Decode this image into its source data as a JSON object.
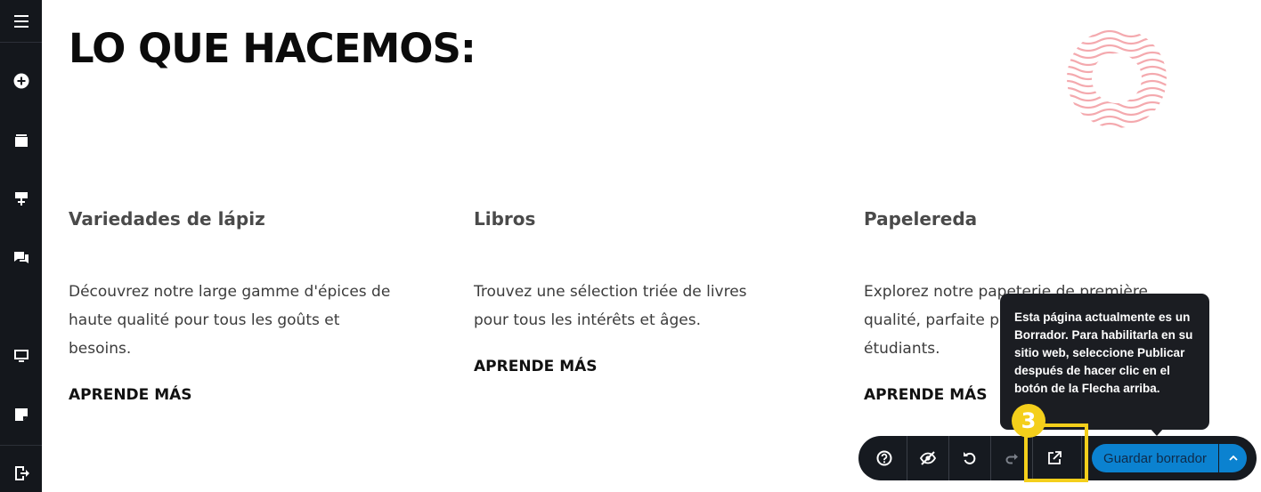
{
  "sidebar": {
    "icons": [
      "menu-icon",
      "add-icon",
      "pages-icon",
      "design-icon",
      "comments-icon",
      "desktop-icon",
      "notes-icon",
      "exit-icon"
    ]
  },
  "page": {
    "title": "LO QUE HACEMOS:",
    "columns": [
      {
        "heading": "Variedades de lápiz",
        "text": "Découvrez notre large gamme d'épices de haute qualité pour tous les goûts et besoins.",
        "link": "APRENDE MÁS"
      },
      {
        "heading": "Libros",
        "text": "Trouvez une sélection triée de livres pour tous les intérêts et âges.",
        "link": "APRENDE MÁS"
      },
      {
        "heading": "Papelereda",
        "text": "Explorez notre papeterie de première qualité, parfaite pour professionnels et étudiants.",
        "link": "APRENDE MÁS"
      }
    ]
  },
  "tooltip": {
    "text": "Esta página actualmente es un Borrador. Para habilitarla en su sitio web, seleccione Publicar después de hacer clic en el botón de la Flecha arriba."
  },
  "toolbar": {
    "icons": [
      "help-icon",
      "hide-icon",
      "undo-icon",
      "redo-icon",
      "publish-icon",
      "chevron-up-icon"
    ],
    "save_label": "Guardar borrador"
  },
  "annotation": {
    "step": "3",
    "color": "#f4cf1b"
  },
  "colors": {
    "sidebar_bg": "#14171c",
    "toolbar_bg": "#161a20",
    "accent": "#0b82d0",
    "decoration": "#f4a9ae"
  }
}
